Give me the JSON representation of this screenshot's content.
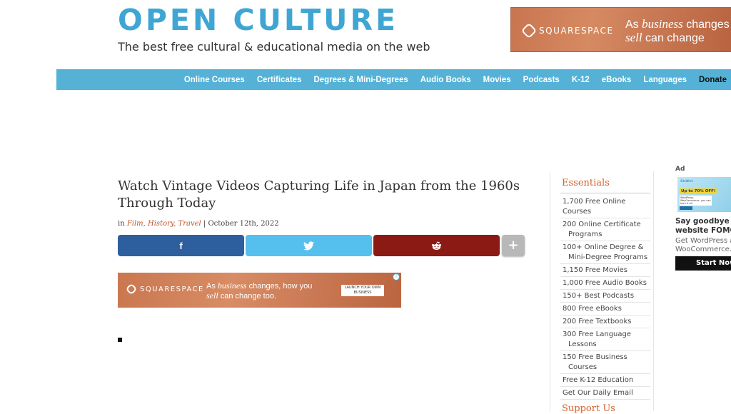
{
  "site": {
    "logo": "OPEN CULTURE",
    "tagline": "The best free cultural & educational media on the web"
  },
  "top_ad": {
    "brand": "SQUARESPACE",
    "line1_pre": "As ",
    "line1_em": "business",
    "line1_post": " changes",
    "line2_em": "sell",
    "line2_post": " can change"
  },
  "nav": {
    "items": [
      "Online Courses",
      "Certificates",
      "Degrees & Mini-Degrees",
      "Audio Books",
      "Movies",
      "Podcasts",
      "K-12",
      "eBooks",
      "Languages"
    ],
    "donate": "Donate"
  },
  "article": {
    "title": "Watch Vintage Videos Capturing Life in Japan from the 1960s Through Today",
    "in_label": "in",
    "categories": "Film, History, Travel",
    "separator": "|",
    "date": "October 12th, 2022"
  },
  "share": {
    "facebook": "f",
    "plus": "+"
  },
  "inline_ad": {
    "brand": "SQUARESPACE",
    "line1_pre": "As ",
    "line1_em": "business",
    "line1_post": " changes, how you",
    "line2_em": "sell",
    "line2_post": " can change too.",
    "cta": "LAUNCH YOUR OWN BUSINESS",
    "choice": "i"
  },
  "sidebar": {
    "essentials_title": "Essentials",
    "items": [
      {
        "line1": "1,700 Free Online Courses"
      },
      {
        "line1": "200 Online Certificate",
        "line2": "Programs"
      },
      {
        "line1": "100+ Online Degree &",
        "line2": "Mini-Degree Programs"
      },
      {
        "line1": "1,150 Free Movies"
      },
      {
        "line1": "1,000 Free Audio Books"
      },
      {
        "line1": "150+ Best Podcasts"
      },
      {
        "line1": "800 Free eBooks"
      },
      {
        "line1": "200 Free Textbooks"
      },
      {
        "line1": "300 Free Language",
        "line2": "Lessons"
      },
      {
        "line1": "150 Free Business",
        "line2": "Courses"
      },
      {
        "line1": "Free K-12 Education"
      },
      {
        "line1": "Get Our Daily Email"
      }
    ],
    "support_title": "Support Us"
  },
  "side_ad": {
    "label": "Ad",
    "thumb_brand": "SiteWork",
    "thumb_badge": "Up to 70% OFF!",
    "thumb_small": "WordPress, WooCommerce, you can here it all.",
    "headline1": "Say goodbye to",
    "headline2": "website FOMO.",
    "body1": "Get WordPress and",
    "body2": "WooCommerce.",
    "button": "Start Now"
  }
}
